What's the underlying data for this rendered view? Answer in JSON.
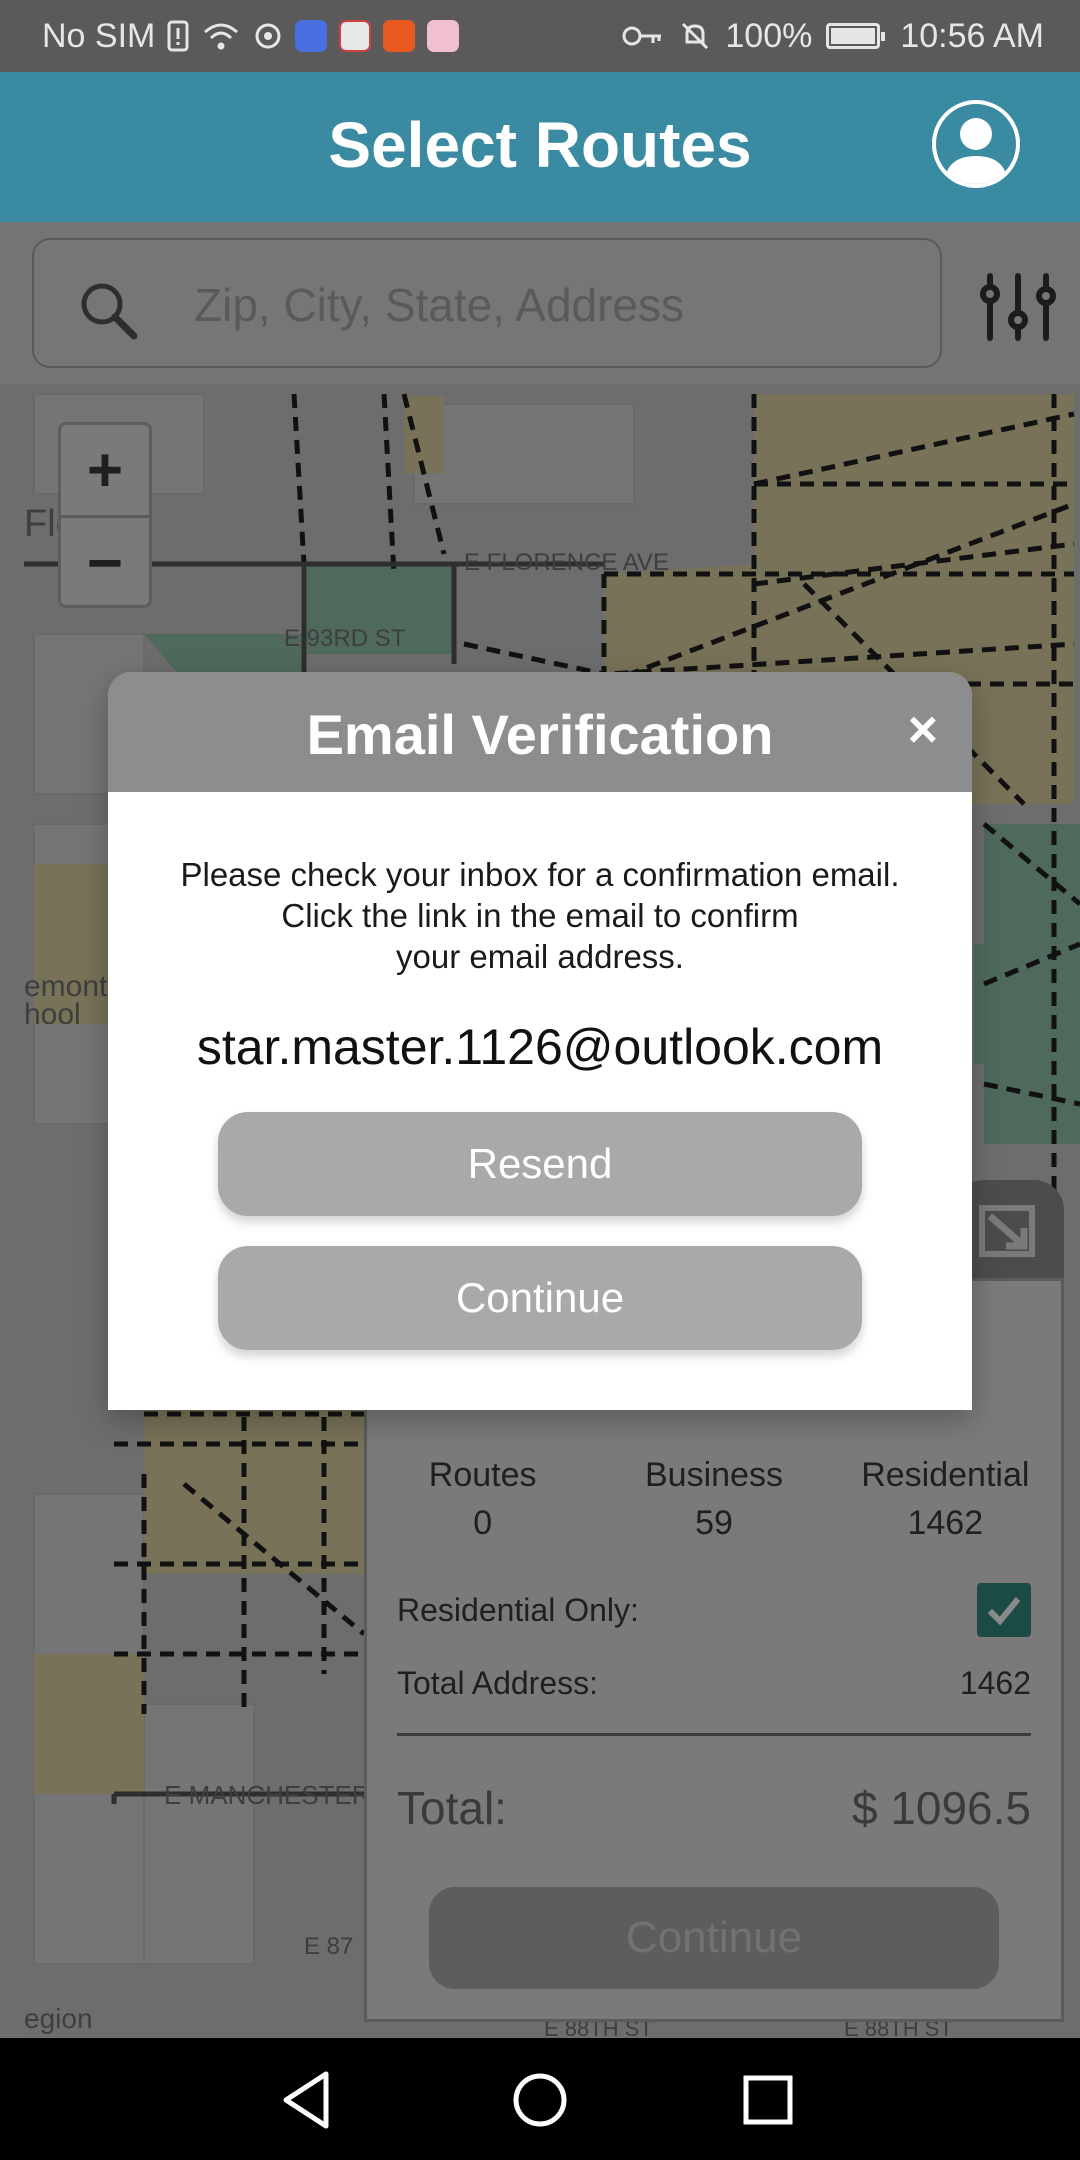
{
  "status_bar": {
    "carrier": "No SIM",
    "battery": "100%",
    "time": "10:56 AM",
    "icons": [
      "sim-alert-icon",
      "wifi-icon",
      "vpn-icon",
      "music-app-icon",
      "maps-app-icon",
      "video-app-icon",
      "photos-app-icon",
      "key-icon",
      "bell-off-icon",
      "battery-icon"
    ]
  },
  "header": {
    "title": "Select Routes",
    "profile_icon": "user-profile-icon",
    "color": "#3a8ba1"
  },
  "search": {
    "placeholder": "Zip, City, State, Address",
    "search_icon": "search-icon",
    "filter_icon": "filter-sliders-icon"
  },
  "map": {
    "zoom_in": "+",
    "zoom_out": "−"
  },
  "panel": {
    "stats": [
      {
        "label": "Routes",
        "value": "0"
      },
      {
        "label": "Business",
        "value": "59"
      },
      {
        "label": "Residential",
        "value": "1462"
      }
    ],
    "residential_only_label": "Residential Only:",
    "residential_only_checked": true,
    "total_address_label": "Total Address:",
    "total_address_value": "1462",
    "total_label": "Total:",
    "total_value": "$ 1096.5",
    "continue_label": "Continue",
    "collapse_icon": "collapse-arrow-icon"
  },
  "modal": {
    "title": "Email Verification",
    "close_label": "×",
    "message_lines": [
      "Please check your inbox for a confirmation email.",
      "Click the link in the email to confirm",
      "your email address."
    ],
    "email": "star.master.1126@outlook.com",
    "resend_label": "Resend",
    "continue_label": "Continue"
  },
  "nav_bar": {
    "back_icon": "back-triangle-icon",
    "home_icon": "home-circle-icon",
    "recents_icon": "recents-square-icon"
  }
}
